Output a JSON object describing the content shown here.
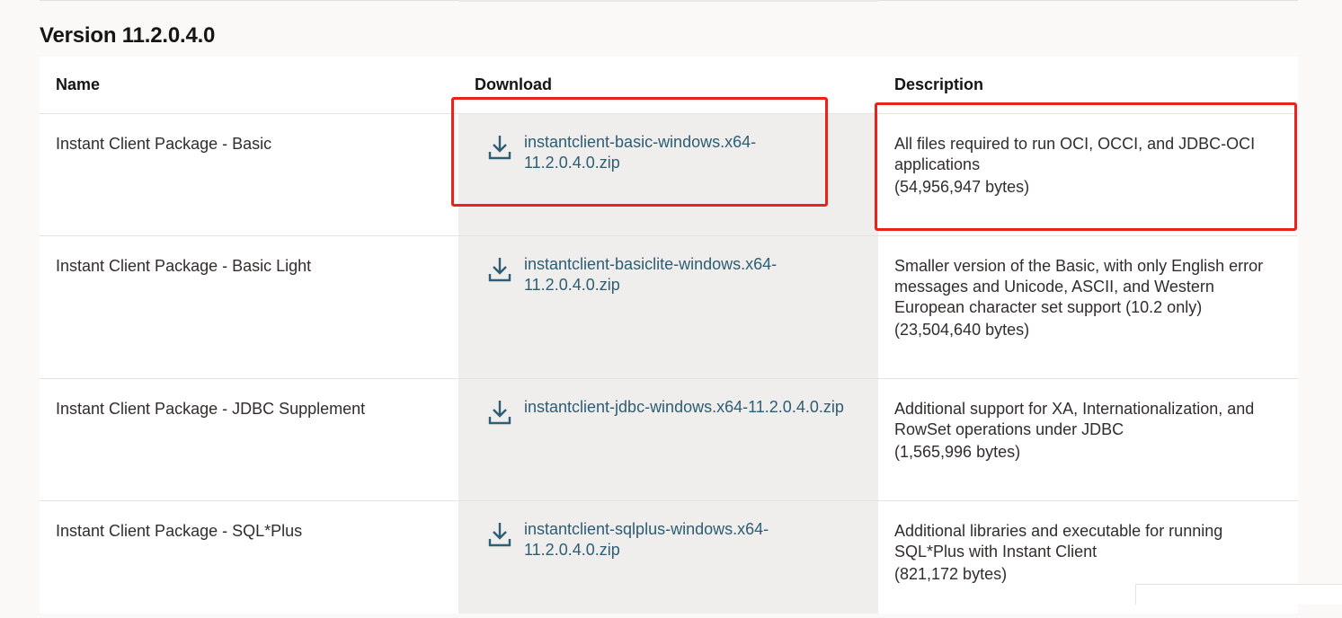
{
  "section": {
    "title": "Version 11.2.0.4.0"
  },
  "table": {
    "headers": {
      "name": "Name",
      "download": "Download",
      "description": "Description"
    },
    "rows": [
      {
        "name": "Instant Client Package - Basic",
        "file": "instantclient-basic-windows.x64-11.2.0.4.0.zip",
        "file_line1": "instantclient-basic-windows.x64-",
        "file_line2": "11.2.0.4.0.zip",
        "description": "All files required to run OCI, OCCI, and JDBC-OCI applications",
        "size": "(54,956,947 bytes)"
      },
      {
        "name": "Instant Client Package - Basic Light",
        "file": "instantclient-basiclite-windows.x64-11.2.0.4.0.zip",
        "file_line1": "instantclient-basiclite-windows.x64-",
        "file_line2": "11.2.0.4.0.zip",
        "description": "Smaller version of the Basic, with only English error messages and Unicode, ASCII, and Western European character set support (10.2 only)",
        "size": "(23,504,640 bytes)"
      },
      {
        "name": "Instant Client Package - JDBC Supplement",
        "file": "instantclient-jdbc-windows.x64-11.2.0.4.0.zip",
        "file_line1": "instantclient-jdbc-windows.x64-11.2.0.4.0.zip",
        "file_line2": "",
        "description": "Additional support for XA, Internationalization, and RowSet operations under JDBC",
        "size": "(1,565,996 bytes)"
      },
      {
        "name": "Instant Client Package - SQL*Plus",
        "file": "instantclient-sqlplus-windows.x64-11.2.0.4.0.zip",
        "file_line1": "instantclient-sqlplus-windows.x64-",
        "file_line2": "11.2.0.4.0.zip",
        "description": "Additional libraries and executable for running SQL*Plus with Instant Client",
        "size": "(821,172 bytes)"
      }
    ]
  },
  "icons": {
    "download": "download-icon"
  },
  "colors": {
    "link": "#2c5e75",
    "highlight": "#e8231c",
    "download_column_bg": "#efeeec"
  }
}
